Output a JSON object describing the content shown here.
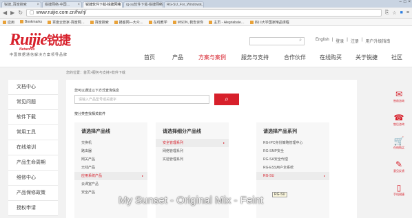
{
  "browser": {
    "tabs": [
      {
        "title": "锐捷_百度搜索",
        "active": false
      },
      {
        "title": "锐捷网络-中国…",
        "active": false
      },
      {
        "title": "锐捷软件下载-锐捷网络",
        "active": true
      },
      {
        "title": "rg-su软件下载-锐捷网络",
        "active": false
      },
      {
        "title": "RG-SU_For_Windows_1…",
        "active": false
      }
    ],
    "url": "www.ruijie.com.cn/fw/rj/",
    "bookmarks": [
      "应用",
      "Bookmarks",
      "百度云管家-百度网…",
      "百度搜索",
      "播客网—大众…",
      "在线教学",
      "MSDN, 我告诉你",
      "主页 - Alegriabale…",
      "四川大学国家精品课程"
    ]
  },
  "site": {
    "logo_text": "Ruijie",
    "logo_cn": "锐捷",
    "logo_networks": "Networks",
    "logo_sub": "中国数据通信解决方案领导品牌",
    "top_links": [
      "English",
      "登录",
      "注册",
      "用户升级指南"
    ],
    "nav": [
      {
        "label": "首页",
        "active": false
      },
      {
        "label": "产品",
        "active": false
      },
      {
        "label": "方案与案例",
        "active": true
      },
      {
        "label": "服务与支持",
        "active": false
      },
      {
        "label": "合作伙伴",
        "active": false
      },
      {
        "label": "在线购买",
        "active": false
      },
      {
        "label": "关于锐捷",
        "active": false
      },
      {
        "label": "社区",
        "active": false
      }
    ],
    "breadcrumb": "您的位置：首页>服务与支持>软件下载"
  },
  "sidebar": {
    "items": [
      "文档中心",
      "常见问题",
      "软件下载",
      "常用工具",
      "在线培训",
      "产品生命周期",
      "维修中心",
      "产品保修政策",
      "授权申请"
    ]
  },
  "search": {
    "title": "您可以通过以下方式查询信息",
    "placeholder": "请输入产品型号或关键字",
    "sub_title": "按分类查找相关软件"
  },
  "columns": [
    {
      "head": "请选择产品线",
      "items": [
        "交换机",
        "路由器",
        "网关产品",
        "无线产品",
        "应用系统产品",
        "云课室产品",
        "安全产品"
      ],
      "selected": 4
    },
    {
      "head": "请选择细分产品线",
      "items": [
        "安全管理系列",
        "网络管理系列",
        "实验管理系列"
      ],
      "selected": 0
    },
    {
      "head": "请选择产品系列",
      "items": [
        "RG-IPC身份策略管理中心",
        "RG-SMP安全",
        "RG-SA安全代理",
        "RG-ESS用户全系统",
        "RG-SU"
      ],
      "selected": 4
    }
  ],
  "tooltip": "RG-SU",
  "float_bar": [
    "售前咨询",
    "售后咨询",
    "在线购买",
    "意见反馈",
    "手机锐捷"
  ],
  "overlay_caption": "My Sunset - Original Mix - Feint"
}
